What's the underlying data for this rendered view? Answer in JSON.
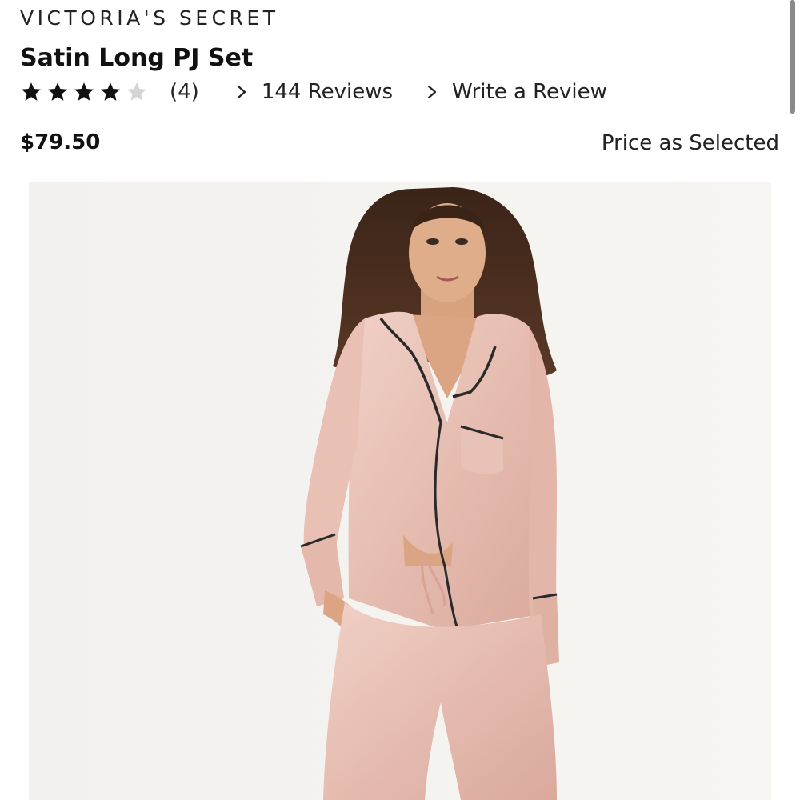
{
  "brand": "VICTORIA'S SECRET",
  "product": {
    "title": "Satin Long PJ Set",
    "rating_value": 4,
    "rating_max": 5,
    "rating_count": "(4)",
    "reviews_link": "144 Reviews",
    "write_review_link": "Write a Review",
    "price": "$79.50",
    "price_note": "Price as Selected"
  },
  "colors": {
    "star_filled": "#111111",
    "star_empty": "#d5d5d5",
    "pajama": "#e9c3b8",
    "piping": "#2a2a2a"
  },
  "icons": {
    "star": "star-icon",
    "chevron": "chevron-right-icon"
  }
}
